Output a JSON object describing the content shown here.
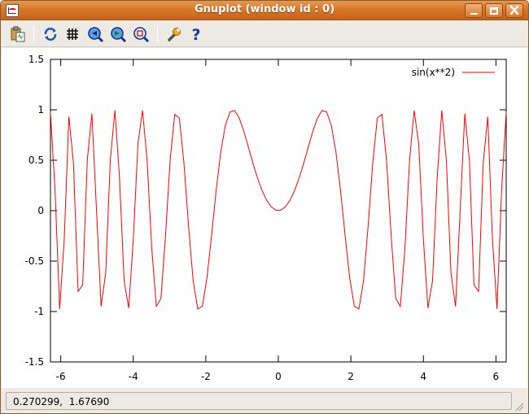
{
  "window": {
    "title": "Gnuplot (window id : 0)",
    "buttons": {
      "minimize": "minimize",
      "maximize": "maximize",
      "close": "close"
    }
  },
  "toolbar": {
    "items": [
      {
        "name": "copy-to-clipboard",
        "icon": "clipboard-icon"
      },
      {
        "name": "replot",
        "icon": "refresh-icon"
      },
      {
        "name": "grid",
        "icon": "grid-icon"
      },
      {
        "name": "previous-zoom",
        "icon": "zoom-previous-icon"
      },
      {
        "name": "next-zoom",
        "icon": "zoom-next-icon"
      },
      {
        "name": "autoscale",
        "icon": "autoscale-icon"
      },
      {
        "name": "options",
        "icon": "wrench-icon"
      },
      {
        "name": "help",
        "icon": "help-icon"
      }
    ]
  },
  "status": {
    "coordinates": "0.270299,  1.67690"
  },
  "colors": {
    "series": "#ff0000",
    "titlebar": "#d8782a"
  },
  "chart_data": {
    "type": "line",
    "function": "sin(x**2)",
    "xlim": [
      -6.283185,
      6.283185
    ],
    "ylim": [
      -1.5,
      1.5
    ],
    "samples": 100,
    "x_ticks": [
      -6,
      -4,
      -2,
      0,
      2,
      4,
      6
    ],
    "x_tick_labels": [
      "-6",
      "-4",
      "-2",
      "0",
      "2",
      "4",
      "6"
    ],
    "y_ticks": [
      -1.5,
      -1,
      -0.5,
      0,
      0.5,
      1,
      1.5
    ],
    "y_tick_labels": [
      "-1.5",
      "-1",
      "-0.5",
      "0",
      "0.5",
      "1",
      "1.5"
    ],
    "series": [
      {
        "name": "sin(x**2)",
        "color": "#ff0000"
      }
    ],
    "legend": "top-right",
    "grid": false
  }
}
